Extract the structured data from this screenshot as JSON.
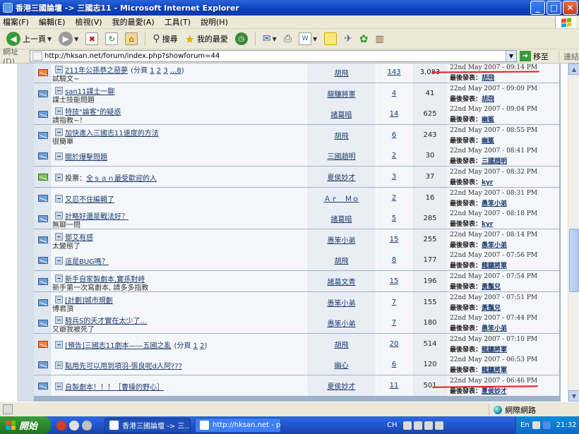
{
  "window": {
    "title": "香港三國論壇 -> 三國志11 - Microsoft Internet Explorer",
    "btn_min": "_",
    "btn_max": "□",
    "btn_close": "✕"
  },
  "menu": [
    "檔案(F)",
    "編輯(E)",
    "檢視(V)",
    "我的最愛(A)",
    "工具(T)",
    "說明(H)"
  ],
  "toolbar": {
    "back": "上一頁",
    "search": "搜尋",
    "favorites": "我的最愛"
  },
  "address": {
    "label": "網址(D)",
    "url": "http://hksan.net/forum/index.php?showforum=44",
    "go": "移至",
    "links": "連結"
  },
  "topics": [
    {
      "icon": "hot",
      "title": "211年公孫恭之惡夢",
      "pages_prefix": "(分頁 ",
      "pages": [
        "1",
        "2",
        "3",
        "...8"
      ],
      "pages_suffix": ")",
      "desc": "試驗文~",
      "author": "胡飛",
      "replies": "143",
      "views": "3,083",
      "date": "22nd May 2007 - 09:14 PM",
      "last_label": "最後發表：",
      "last_by": "胡飛"
    },
    {
      "icon": "normal",
      "title": "san11諜士一聊",
      "desc": "諜士技能問題",
      "author": "龍驤將軍",
      "replies": "4",
      "views": "41",
      "date": "22nd May 2007 - 09:09 PM",
      "last_label": "最後發表：",
      "last_by": "胡飛"
    },
    {
      "icon": "normal",
      "title": "特技\"論客\"的疑惑",
      "desc": "請指教~！",
      "author": "諸葛暗",
      "replies": "14",
      "views": "625",
      "date": "22nd May 2007 - 09:04 PM",
      "last_label": "最後發表：",
      "last_by": "幽鯊"
    },
    {
      "icon": "normal",
      "title": "加快進入三國志11速度的方法",
      "desc": "很簡單",
      "author": "胡飛",
      "replies": "6",
      "views": "243",
      "date": "22nd May 2007 - 08:55 PM",
      "last_label": "最後發表：",
      "last_by": "幽鯊"
    },
    {
      "icon": "normal",
      "title": "關於爆擊問題",
      "desc": "",
      "author": "三國趙明",
      "replies": "2",
      "views": "30",
      "date": "22nd May 2007 - 08:41 PM",
      "last_label": "最後發表：",
      "last_by": "三國趙明"
    },
    {
      "icon": "poll",
      "title": "全ｓａｎ最受歡迎的人",
      "prefix": "投票：",
      "desc": "",
      "author": "夏侯妙才",
      "replies": "3",
      "views": "37",
      "date": "22nd May 2007 - 08:32 PM",
      "last_label": "最後發表：",
      "last_by": "kyr"
    },
    {
      "icon": "normal",
      "title": "又忍不住編輯了",
      "desc": "",
      "author": "Ａｒ　Ｍｏ",
      "replies": "2",
      "views": "16",
      "date": "22nd May 2007 - 08:31 PM",
      "last_label": "最後發表：",
      "last_by": "愚笨小弟"
    },
    {
      "icon": "normal",
      "title": "計略好還是戰法好？",
      "desc": "無聊一問",
      "author": "諸葛暗",
      "replies": "5",
      "views": "285",
      "date": "22nd May 2007 - 08:18 PM",
      "last_label": "最後發表：",
      "last_by": "kyr"
    },
    {
      "icon": "normal",
      "title": "鄧艾有感",
      "desc": "太變態了",
      "author": "愚笨小弟",
      "replies": "15",
      "views": "255",
      "date": "22nd May 2007 - 08:14 PM",
      "last_label": "最後發表：",
      "last_by": "愚笨小弟"
    },
    {
      "icon": "normal",
      "title": "這是BUG嗎？",
      "desc": "",
      "author": "胡飛",
      "replies": "8",
      "views": "177",
      "date": "22nd May 2007 - 07:56 PM",
      "last_label": "最後發表：",
      "last_by": "龍驤將軍"
    },
    {
      "icon": "lock",
      "title": "新手自家製劇本,實孫對峙",
      "desc": "新手第一次寫劇本, 請多多指教",
      "author": "諸葛文青",
      "replies": "15",
      "views": "196",
      "date": "22nd May 2007 - 07:54 PM",
      "last_label": "最後發表：",
      "last_by": "黃鬚兒"
    },
    {
      "icon": "normal",
      "title": "[計劃]城市規劃",
      "desc": "博君頂",
      "author": "愚笨小弟",
      "replies": "7",
      "views": "155",
      "date": "22nd May 2007 - 07:51 PM",
      "last_label": "最後發表：",
      "last_by": "黃鬚兒"
    },
    {
      "icon": "normal",
      "title": "騎兵S的天才實在太少了…",
      "desc": "又爺我被死了",
      "author": "愚笨小弟",
      "replies": "7",
      "views": "180",
      "date": "22nd May 2007 - 07:44 PM",
      "last_label": "最後發表：",
      "last_by": "愚笨小弟"
    },
    {
      "icon": "hotlock",
      "title": "[預告]三國志11劇本——五國之亂",
      "pages_prefix": "(分頁 ",
      "pages": [
        "1",
        "2"
      ],
      "pages_suffix": ")",
      "desc": "",
      "author": "胡飛",
      "replies": "20",
      "views": "514",
      "date": "22nd May 2007 - 07:10 PM",
      "last_label": "最後發表：",
      "last_by": "龍驤將軍"
    },
    {
      "icon": "normal",
      "title": "點用先可以用到項羽-張良呢d人阿???",
      "desc": "",
      "author": "幽心",
      "replies": "6",
      "views": "120",
      "date": "22nd May 2007 - 06:53 PM",
      "last_label": "最後發表：",
      "last_by": "龍驤將軍"
    },
    {
      "icon": "lock",
      "title": "自製劇本！！！［曹操的野心］",
      "desc": "",
      "author": "夏侯妙才",
      "replies": "11",
      "views": "501",
      "date": "22nd May 2007 - 06:46 PM",
      "last_label": "最後發表：",
      "last_by": "夏侯妙才"
    }
  ],
  "statusbar": {
    "zone": "網際網路"
  },
  "taskbar": {
    "start": "開始",
    "tasks": [
      "香港三國論壇 -> 三...",
      "http://hksan.net - php..."
    ],
    "lang": "CH",
    "ime": "En",
    "time": "21:32"
  },
  "colors": {
    "title_bar": "#0A3FBE",
    "board_border": "#9DB3CC",
    "link": "#1C3A6E",
    "annotation": "#e02020"
  }
}
